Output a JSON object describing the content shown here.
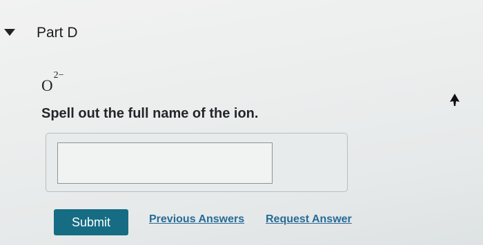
{
  "part": {
    "title": "Part D"
  },
  "question": {
    "formula_base": "O",
    "formula_charge": "2−",
    "prompt": "Spell out the full name of the ion."
  },
  "answer": {
    "value": ""
  },
  "actions": {
    "submit_label": "Submit",
    "previous_answers_label": "Previous Answers",
    "request_answer_label": "Request Answer"
  },
  "colors": {
    "submit_bg": "#166c83",
    "link": "#276a97"
  },
  "icons": {
    "collapse": "caret-down-icon",
    "pointer": "mouse-cursor-icon"
  }
}
